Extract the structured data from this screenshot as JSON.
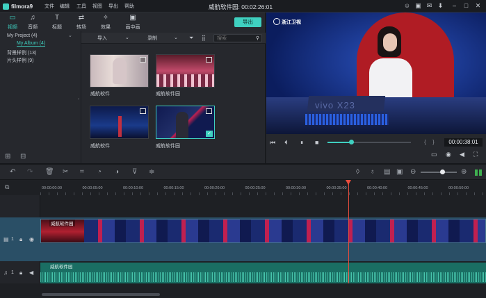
{
  "app": {
    "name": "filmora9",
    "window_title": "威航软件园:  00:02:26:01"
  },
  "menu": [
    "文件",
    "编辑",
    "工具",
    "视图",
    "导出",
    "帮助"
  ],
  "tabs": [
    {
      "label": "视频",
      "icon": "folder-icon"
    },
    {
      "label": "音频",
      "icon": "music-icon"
    },
    {
      "label": "标题",
      "icon": "text-icon"
    },
    {
      "label": "转场",
      "icon": "transition-icon"
    },
    {
      "label": "效果",
      "icon": "effects-icon"
    },
    {
      "label": "画中画",
      "icon": "pip-icon"
    }
  ],
  "export_label": "导出",
  "sidebar": {
    "project": "My Project (4)",
    "album": "My Album (4)",
    "bg": "背景样例 (13)",
    "intro": "片头样例 (9)"
  },
  "toolbar": {
    "import": "导入",
    "record": "录制",
    "search_placeholder": "搜索"
  },
  "media": [
    {
      "caption": "威航软件"
    },
    {
      "caption": "威航软件园"
    },
    {
      "caption": "威航软件"
    },
    {
      "caption": "威航软件园"
    }
  ],
  "preview": {
    "channel": "浙江卫视",
    "brand": "vivo X23",
    "time": "00:00:38:01",
    "progress": 0.28
  },
  "timeline": {
    "ticks": [
      "00:00:00:00",
      "00:00:05:00",
      "00:00:10:00",
      "00:00:15:00",
      "00:00:20:00",
      "00:00:25:00",
      "00:00:30:00",
      "00:00:35:00",
      "00:00:40:00",
      "00:00:45:00",
      "00:00:50:00"
    ],
    "video_clip": "威航软件园",
    "audio_clip": "威航软件园",
    "video_track_label": "1",
    "audio_track_label": "1",
    "playhead_time": "00:00:35:00"
  },
  "colors": {
    "accent": "#3fd0c0",
    "playhead": "#e74c3c"
  }
}
